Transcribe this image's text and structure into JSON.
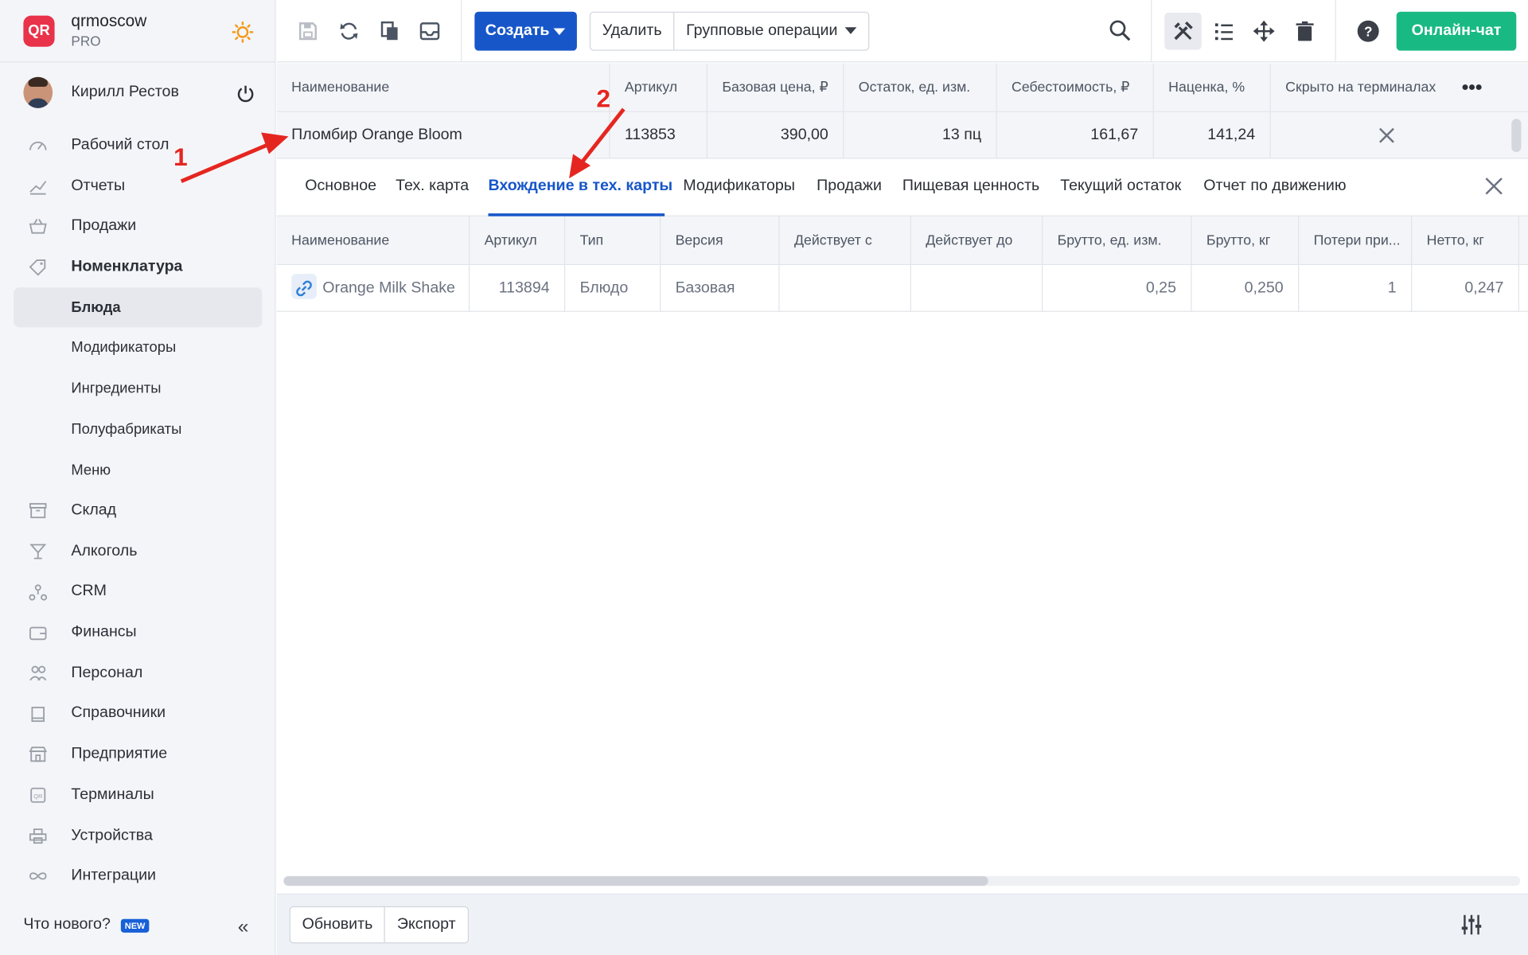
{
  "brand": {
    "name": "qrmoscow",
    "plan": "PRO",
    "logo_text": "QR"
  },
  "user": {
    "name": "Кирилл Рестов"
  },
  "nav": {
    "items": [
      {
        "label": "Рабочий стол",
        "icon": "dashboard-icon"
      },
      {
        "label": "Отчеты",
        "icon": "reports-icon"
      },
      {
        "label": "Продажи",
        "icon": "basket-icon"
      },
      {
        "label": "Номенклатура",
        "icon": "tag-icon"
      }
    ],
    "subitems": [
      {
        "label": "Блюда",
        "active": true
      },
      {
        "label": "Модификаторы"
      },
      {
        "label": "Ингредиенты"
      },
      {
        "label": "Полуфабрикаты"
      },
      {
        "label": "Меню"
      }
    ],
    "items2": [
      {
        "label": "Склад",
        "icon": "warehouse-icon"
      },
      {
        "label": "Алкоголь",
        "icon": "cocktail-icon"
      },
      {
        "label": "CRM",
        "icon": "crm-icon"
      },
      {
        "label": "Финансы",
        "icon": "wallet-icon"
      },
      {
        "label": "Персонал",
        "icon": "staff-icon"
      },
      {
        "label": "Справочники",
        "icon": "book-icon"
      },
      {
        "label": "Предприятие",
        "icon": "store-icon"
      },
      {
        "label": "Терминалы",
        "icon": "terminal-icon"
      },
      {
        "label": "Устройства",
        "icon": "printer-icon"
      },
      {
        "label": "Интеграции",
        "icon": "infinity-icon"
      }
    ]
  },
  "footer": {
    "whats_new": "Что нового?",
    "new_badge": "NEW"
  },
  "toolbar": {
    "create": "Создать",
    "delete": "Удалить",
    "group_ops": "Групповые операции",
    "chat": "Онлайн-чат"
  },
  "main_table": {
    "columns": [
      "Наименование",
      "Артикул",
      "Базовая цена, ₽",
      "Остаток, ед. изм.",
      "Себестоимость, ₽",
      "Наценка, %",
      "Скрыто на терминалах"
    ],
    "row": {
      "name": "Пломбир Orange Bloom",
      "sku": "113853",
      "price": "390,00",
      "stock": "13 пц",
      "cost": "161,67",
      "markup": "141,24"
    }
  },
  "tabs": [
    "Основное",
    "Тех. карта",
    "Вхождение в тех. карты",
    "Модификаторы",
    "Продажи",
    "Пищевая ценность",
    "Текущий остаток",
    "Отчет по движению"
  ],
  "sub_table": {
    "columns": [
      "Наименование",
      "Артикул",
      "Тип",
      "Версия",
      "Действует с",
      "Действует до",
      "Брутто, ед. изм.",
      "Брутто, кг",
      "Потери при...",
      "Нетто, кг"
    ],
    "row": {
      "name": "Orange Milk Shake",
      "sku": "113894",
      "type": "Блюдо",
      "version": "Базовая",
      "from": "",
      "to": "",
      "gross_unit": "0,25",
      "gross_kg": "0,250",
      "loss": "1",
      "net_kg": "0,247"
    }
  },
  "bottom": {
    "refresh": "Обновить",
    "export": "Экспорт"
  },
  "annotations": {
    "one": "1",
    "two": "2"
  },
  "colors": {
    "accent": "#1756c9",
    "chat": "#18b982",
    "arrow": "#e52620",
    "logo": "#e8334a"
  }
}
